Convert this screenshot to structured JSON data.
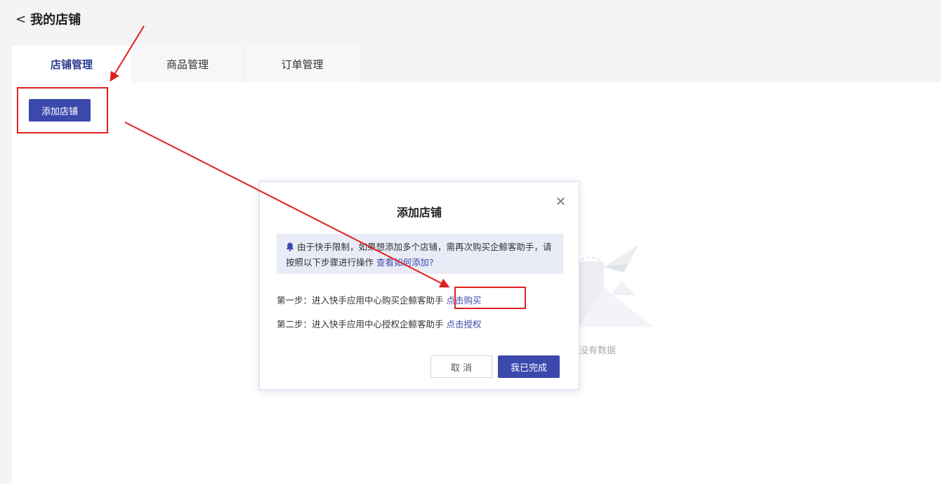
{
  "header": {
    "back_label": "我的店铺"
  },
  "tabs": [
    {
      "label": "店铺管理",
      "active": true
    },
    {
      "label": "商品管理",
      "active": false
    },
    {
      "label": "订单管理",
      "active": false
    }
  ],
  "toolbar": {
    "add_store_label": "添加店铺"
  },
  "empty_state": {
    "text": "没有数据"
  },
  "modal": {
    "title": "添加店铺",
    "notice": {
      "text": "由于快手限制，如果想添加多个店铺，需再次购买企鲸客助手，请按照以下步骤进行操作",
      "link": "查看如何添加?"
    },
    "steps": [
      {
        "text": "第一步：进入快手应用中心购买企鲸客助手",
        "link": "点击购买"
      },
      {
        "text": "第二步：进入快手应用中心授权企鲸客助手",
        "link": "点击授权"
      }
    ],
    "cancel_label": "取 消",
    "confirm_label": "我已完成"
  },
  "colors": {
    "primary": "#3b49ad",
    "annotation": "#e02020"
  }
}
